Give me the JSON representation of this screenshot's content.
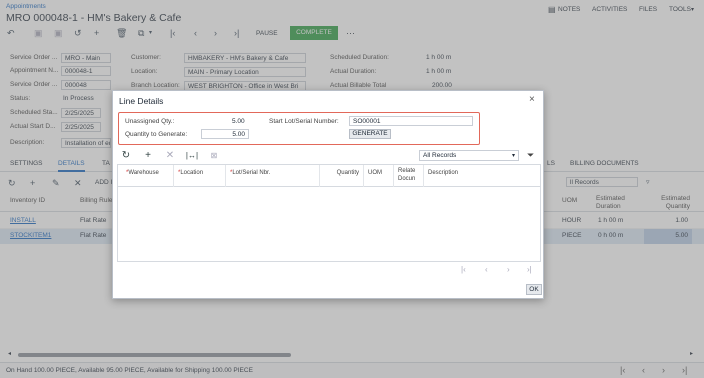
{
  "breadcrumb": "Appointments",
  "page_title": "MRO 000048-1 - HM's Bakery & Cafe",
  "top_menu": {
    "notes": "NOTES",
    "activities": "ACTIVITIES",
    "files": "FILES",
    "tools": "TOOLS"
  },
  "toolbar": {
    "pause": "PAUSE",
    "complete": "COMPLETE",
    "more": "···"
  },
  "form": {
    "service_order_type_label": "Service Order ...",
    "service_order_type_value": "MRO - Main",
    "appointment_nbr_label": "Appointment N...",
    "appointment_nbr_value": "000048-1",
    "service_order_nbr_label": "Service Order ...",
    "service_order_nbr_value": "000048",
    "status_label": "Status:",
    "status_value": "In Process",
    "scheduled_start_label": "Scheduled Sta...",
    "scheduled_start_value": "2/25/2025",
    "actual_start_label": "Actual Start D...",
    "actual_start_value": "2/25/2025",
    "description_label": "Description:",
    "description_value": "Installation of eqi",
    "customer_label": "Customer:",
    "customer_value": "HMBAKERY - HM's Bakery & Cafe",
    "location_label": "Location:",
    "location_value": "MAIN - Primary Location",
    "branch_location_label": "Branch Location:",
    "branch_location_value": "WEST BRIGHTON - Office in West Bri",
    "scheduled_duration_label": "Scheduled Duration:",
    "scheduled_duration_value": "1 h 00 m",
    "actual_duration_label": "Actual Duration:",
    "actual_duration_value": "1 h 00 m",
    "actual_billable_label": "Actual Billable Total",
    "actual_billable_value": "200.00"
  },
  "tabs": {
    "settings": "SETTINGS",
    "details": "DETAILS",
    "tax_partial": "TA",
    "billing_documents": "BILLING DOCUMENTS",
    "ls_partial": "LS"
  },
  "grid": {
    "add_partial": "ADD I",
    "columns": [
      "Inventory ID",
      "Billing Rule",
      "UOM",
      "Estimated Duration",
      "Estimated Quantity"
    ],
    "rows": [
      {
        "inventory_id": "INSTALL",
        "billing_rule": "Flat Rate",
        "uom": "HOUR",
        "est_duration": "1 h 00 m",
        "est_qty": "1.00"
      },
      {
        "inventory_id": "STOCKITEM1",
        "billing_rule": "Flat Rate",
        "uom": "PIECE",
        "est_duration": "0 h 00 m",
        "est_qty": "5.00"
      }
    ],
    "filter_partial": "ll Records"
  },
  "status_bar": "On Hand 100.00 PIECE, Available 95.00 PIECE, Available for Shipping 100.00 PIECE",
  "dialog": {
    "title": "Line Details",
    "unassigned_label": "Unassigned Qty.:",
    "unassigned_value": "5.00",
    "qty_to_generate_label": "Quantity to Generate:",
    "qty_to_generate_value": "5.00",
    "start_lot_label": "Start Lot/Serial Number:",
    "start_lot_value": "SO00001",
    "generate_button": "GENERATE",
    "filter_value": "All Records",
    "columns": [
      "Warehouse",
      "Location",
      "Lot/Serial Nbr.",
      "Quantity",
      "UOM",
      "Relate Docun",
      "Description"
    ],
    "ok_button": "OK"
  }
}
